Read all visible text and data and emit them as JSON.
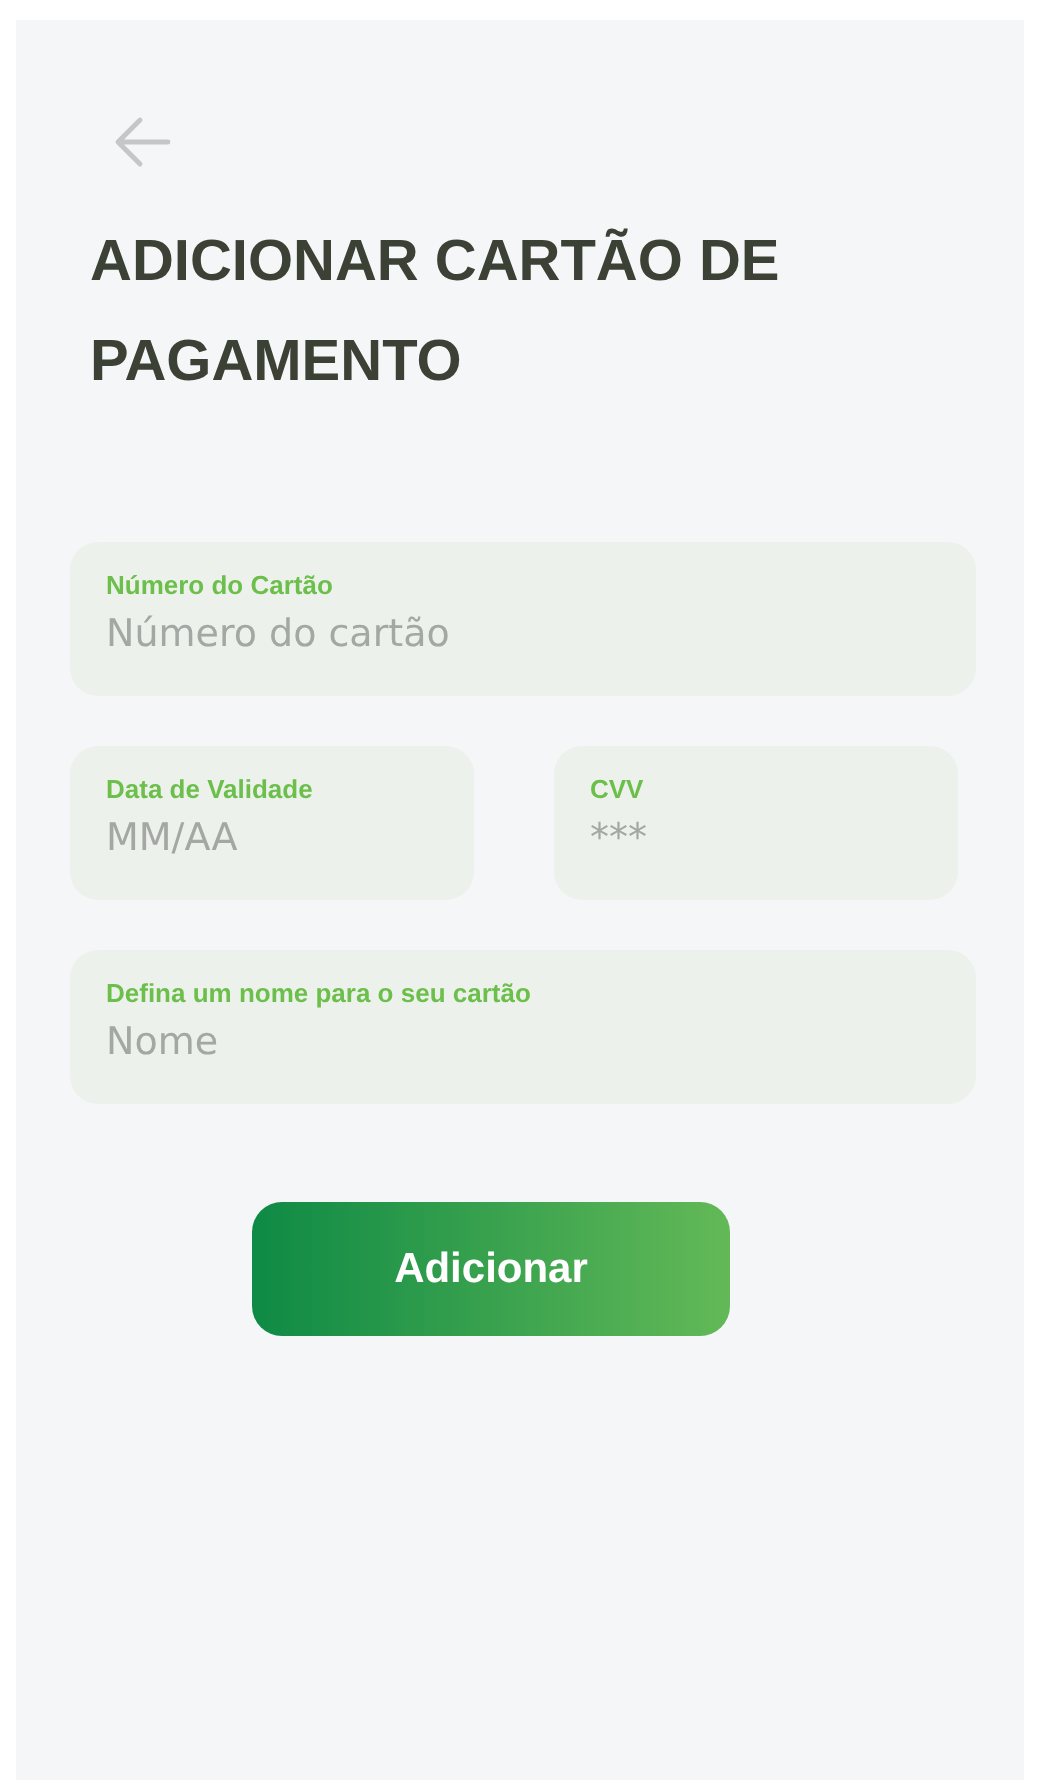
{
  "title": "ADICIONAR CARTÃO DE PAGAMENTO",
  "fields": [
    {
      "label": "Número do Cartão",
      "placeholder": "Número do cartão",
      "kind": "wide"
    },
    {
      "label": "Data de Validade",
      "placeholder": "MM/AA",
      "kind": "half"
    },
    {
      "label": "CVV",
      "placeholder": "***",
      "kind": "half"
    },
    {
      "label": "Defina um nome para o seu cartão",
      "placeholder": "Nome",
      "kind": "wide"
    }
  ],
  "button": "Adicionar"
}
